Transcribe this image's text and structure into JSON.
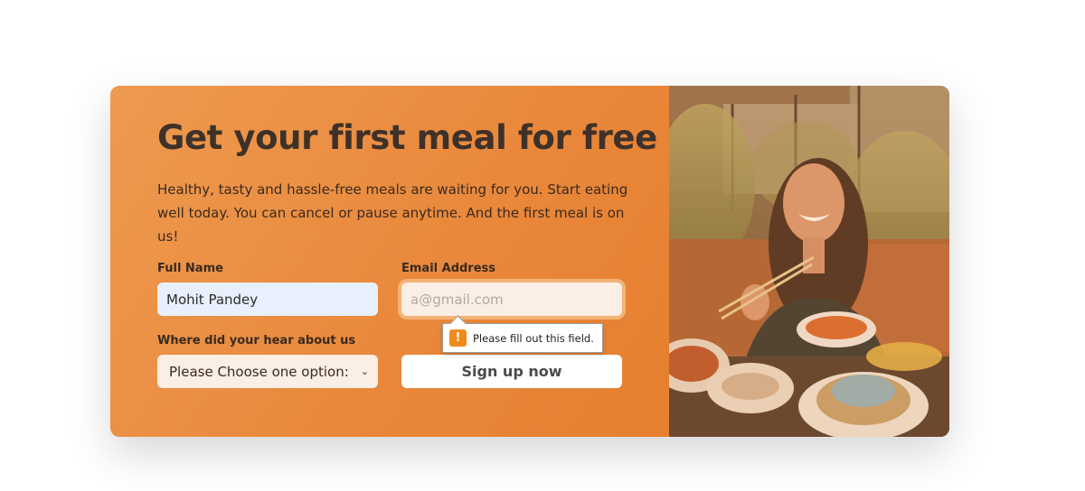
{
  "signup_card": {
    "title": "Get your first meal for free",
    "description": "Healthy, tasty and hassle-free meals are waiting for you. Start eating well today. You can cancel or pause anytime. And the first meal is on us!",
    "full_name": {
      "label": "Full Name",
      "value": "Mohit Pandey"
    },
    "email": {
      "label": "Email Address",
      "placeholder": "a@gmail.com",
      "value": ""
    },
    "source": {
      "label": "Where did your hear about us",
      "selected": "Please Choose one option:"
    },
    "submit_label": "Sign up now",
    "validation_message": "Please fill out this field.",
    "validation_icon": "!"
  },
  "colors": {
    "accent": "#e9873a",
    "title_text": "#3e3129",
    "input_bg": "#fbeee4",
    "autofill_bg": "#e8f0fe",
    "warning": "#f08a1c"
  },
  "photo": {
    "alt": "Smiling woman eating dumplings with chopsticks at a restaurant table"
  }
}
